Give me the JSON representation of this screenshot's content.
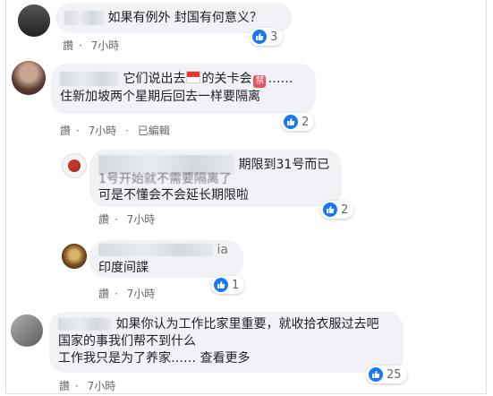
{
  "comments": [
    {
      "text": "如果有例外 封国有何意义？",
      "actions": [
        "讚",
        "·",
        "7小時"
      ],
      "reaction_count": "3"
    },
    {
      "text_part1": "它们说出去",
      "text_part2": "的关卡会",
      "text_tail": "……",
      "text_line2": "住新加坡两个星期后回去一样要隔离",
      "actions": [
        "讚",
        "·",
        "7小時",
        "·",
        "已編輯"
      ],
      "reaction_count": "2",
      "icons": [
        "flag-icon",
        "forbidden-icon"
      ]
    },
    {
      "text_line1": "期限到31号而已",
      "text_line2": "1号开始就不需要隔离了",
      "text_line3": "可是不懂会不会延长期限啦",
      "actions": [
        "讚",
        "·",
        "7小時"
      ],
      "reaction_count": "2"
    },
    {
      "name_visible": "ia",
      "text": "印度间諜",
      "actions": [
        "讚",
        "·",
        "7小時"
      ],
      "reaction_count": "1"
    },
    {
      "text_line1": "如果你认为工作比家里重要，就收拾衣服过去吧",
      "text_line2": "国家的事我们帮不到什么",
      "text_line3": "工作我只是为了养家……",
      "see_more": "查看更多",
      "actions": [
        "讚",
        "·",
        "7小時"
      ],
      "reaction_count": "25"
    }
  ],
  "colors": {
    "like_blue": "#1877f2",
    "bubble_bg": "#f0f2f5",
    "meta_text": "#65676b"
  }
}
